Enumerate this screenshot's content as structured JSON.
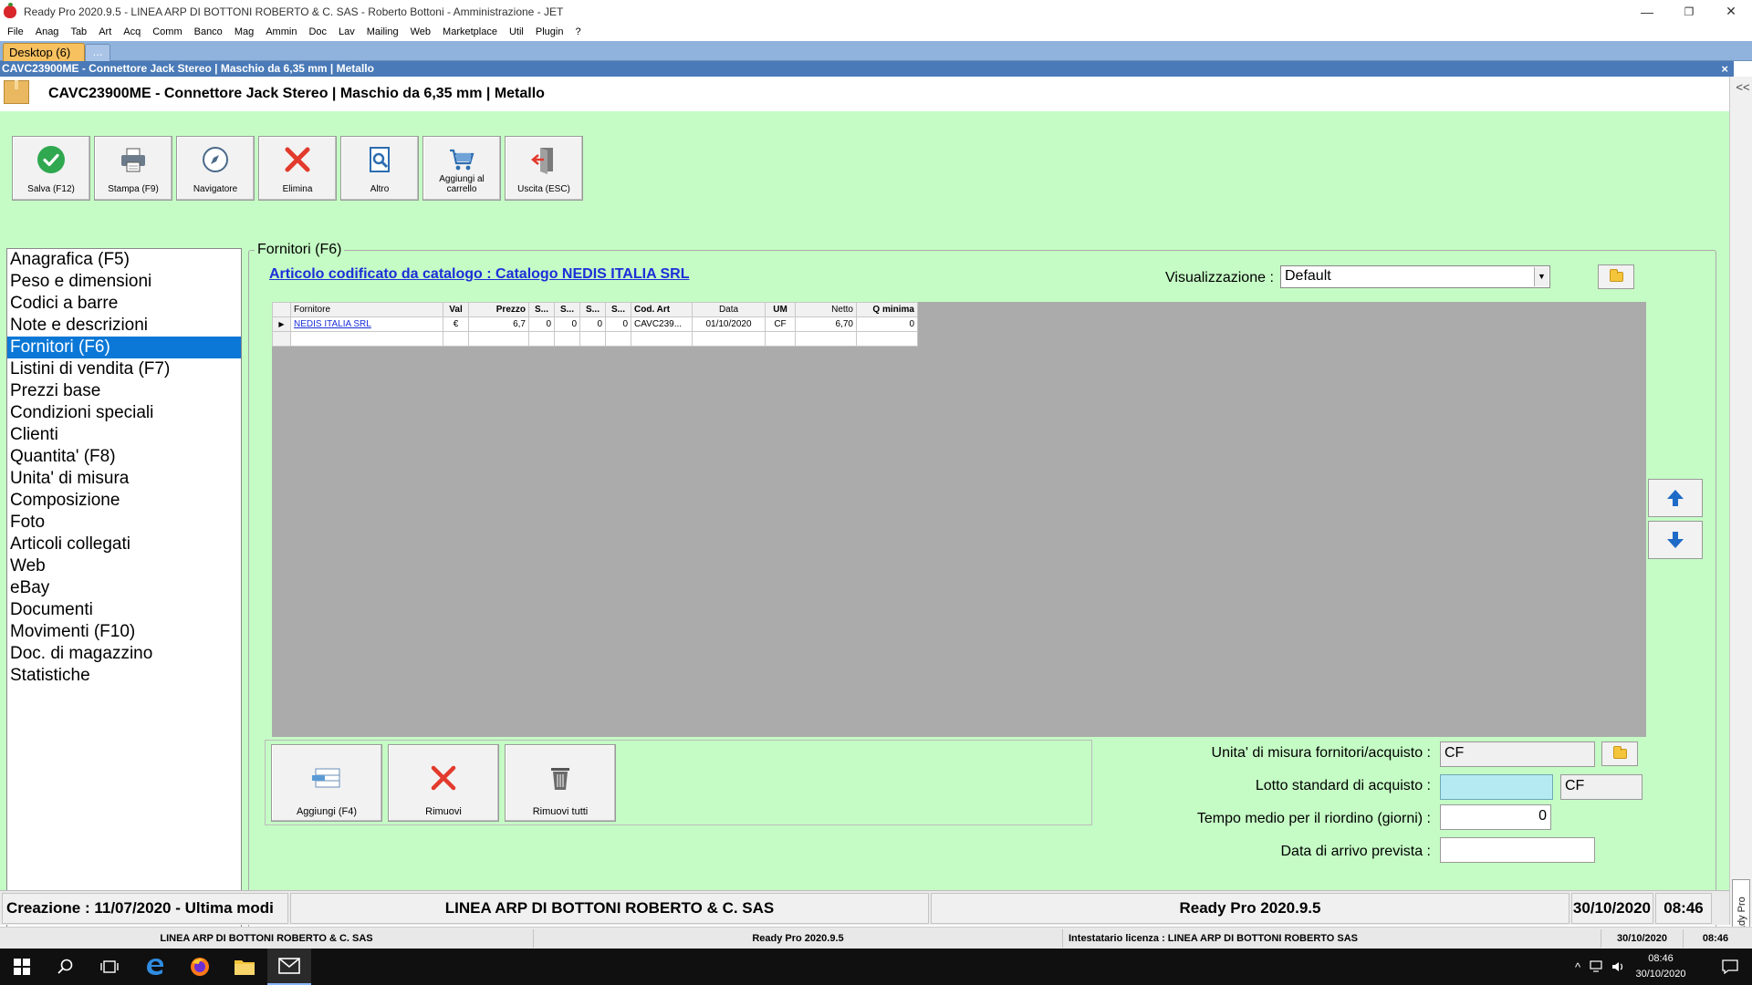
{
  "window": {
    "title": "Ready Pro 2020.9.5 - LINEA ARP DI BOTTONI ROBERTO & C. SAS - Roberto Bottoni - Amministrazione - JET",
    "minimize": "—",
    "restore": "❐",
    "close": "✕"
  },
  "menu": [
    "File",
    "Anag",
    "Tab",
    "Art",
    "Acq",
    "Comm",
    "Banco",
    "Mag",
    "Ammin",
    "Doc",
    "Lav",
    "Mailing",
    "Web",
    "Marketplace",
    "Util",
    "Plugin",
    "?"
  ],
  "tabs": {
    "desktop": "Desktop  (6)",
    "more": "..."
  },
  "doc_caption": "CAVC23900ME - Connettore Jack Stereo  |  Maschio da 6,35 mm  |  Metallo",
  "doc_close": "×",
  "article_title": "CAVC23900ME - Connettore Jack Stereo | Maschio da 6,35 mm | Metallo",
  "collapse": "<<",
  "toolbar": [
    {
      "label": "Salva (F12)",
      "icon": "check-icon"
    },
    {
      "label": "Stampa (F9)",
      "icon": "printer-icon"
    },
    {
      "label": "Navigatore",
      "icon": "compass-icon"
    },
    {
      "label": "Elimina",
      "icon": "delete-x-icon"
    },
    {
      "label": "Altro",
      "icon": "search-doc-icon"
    },
    {
      "label": "Aggiungi al carrello",
      "icon": "cart-icon"
    },
    {
      "label": "Uscita (ESC)",
      "icon": "exit-icon"
    }
  ],
  "nav": [
    "Anagrafica (F5)",
    "Peso e dimensioni",
    "Codici a barre",
    "Note e descrizioni",
    "Fornitori (F6)",
    "Listini di vendita (F7)",
    "Prezzi base",
    "Condizioni speciali",
    "Clienti",
    "Quantita' (F8)",
    "Unita' di misura",
    "Composizione",
    "Foto",
    "Articoli collegati",
    "Web",
    "eBay",
    "Documenti",
    "Movimenti (F10)",
    "Doc. di magazzino",
    "Statistiche"
  ],
  "nav_selected": 4,
  "group_title": "Fornitori (F6)",
  "catalog_link": "Articolo codificato da catalogo : Catalogo NEDIS ITALIA SRL",
  "visualizzazione": {
    "label": "Visualizzazione :",
    "value": "Default",
    "dd": "▼"
  },
  "grid": {
    "headers": [
      "Fornitore",
      "Val",
      "Prezzo",
      "S...",
      "S...",
      "S...",
      "S...",
      "Cod. Art",
      "Data",
      "UM",
      "Netto",
      "Q minima"
    ],
    "rows": [
      {
        "indicator": "▶",
        "cells": [
          "NEDIS ITALIA SRL",
          "€",
          "6,7",
          "0",
          "0",
          "0",
          "0",
          "CAVC239...",
          "01/10/2020",
          "CF",
          "6,70",
          "0"
        ]
      }
    ]
  },
  "commands": [
    {
      "label": "Aggiungi (F4)",
      "icon": "add-row-icon"
    },
    {
      "label": "Rimuovi",
      "icon": "remove-x-icon"
    },
    {
      "label": "Rimuovi tutti",
      "icon": "trash-icon"
    }
  ],
  "form": {
    "um_label": "Unita' di misura fornitori/acquisto :",
    "um_value": "CF",
    "lotto_label": "Lotto standard di acquisto :",
    "lotto_value": "",
    "lotto_unit": "CF",
    "tempo_label": "Tempo medio per il riordino (giorni) :",
    "tempo_value": "0",
    "data_label": "Data di arrivo prevista :",
    "data_value": ""
  },
  "statusbar": {
    "creation": "Creazione : 11/07/2020 - Ultima modi",
    "company": "LINEA ARP DI BOTTONI ROBERTO & C. SAS",
    "version": "Ready Pro 2020.9.5",
    "date": "30/10/2020",
    "time": "08:46"
  },
  "statusbar2": {
    "company": "LINEA ARP DI BOTTONI ROBERTO & C. SAS",
    "version": "Ready Pro 2020.9.5",
    "license": "Intestatario licenza : LINEA ARP DI BOTTONI ROBERTO SAS",
    "date": "30/10/2020",
    "time": "08:46"
  },
  "assistant": "Assistente Ready Pro",
  "taskbar": {
    "clock_time": "08:46",
    "clock_date": "30/10/2020",
    "tray_chevron": "^"
  },
  "colors": {
    "work_bg": "#c5fcc5",
    "selected": "#0b78d7",
    "caption": "#4a7ab7",
    "link": "#1a2fd8"
  }
}
